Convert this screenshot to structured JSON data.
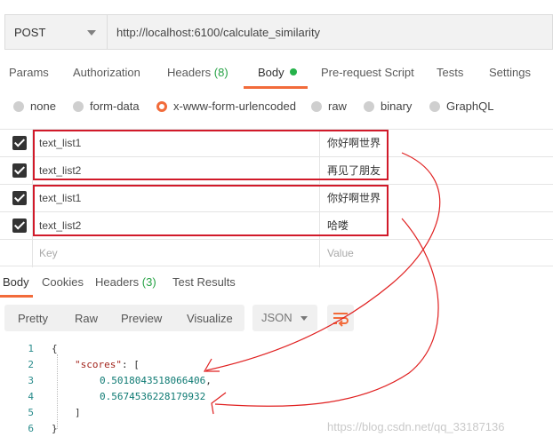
{
  "request": {
    "method": "POST",
    "url": "http://localhost:6100/calculate_similarity"
  },
  "request_tabs": [
    {
      "label": "Params"
    },
    {
      "label": "Authorization"
    },
    {
      "label": "Headers",
      "count": "(8)"
    },
    {
      "label": "Body"
    },
    {
      "label": "Pre-request Script"
    },
    {
      "label": "Tests"
    },
    {
      "label": "Settings"
    }
  ],
  "body_types": [
    {
      "label": "none"
    },
    {
      "label": "form-data"
    },
    {
      "label": "x-www-form-urlencoded"
    },
    {
      "label": "raw"
    },
    {
      "label": "binary"
    },
    {
      "label": "GraphQL"
    }
  ],
  "params": [
    {
      "key": "text_list1",
      "value": "你好啊世界"
    },
    {
      "key": "text_list2",
      "value": "再见了朋友"
    },
    {
      "key": "text_list1",
      "value": "你好啊世界"
    },
    {
      "key": "text_list2",
      "value": "哈喽"
    }
  ],
  "placeholder": {
    "key": "Key",
    "value": "Value"
  },
  "response_tabs": [
    {
      "label": "Body"
    },
    {
      "label": "Cookies"
    },
    {
      "label": "Headers",
      "count": "(3)"
    },
    {
      "label": "Test Results"
    }
  ],
  "view_modes": [
    "Pretty",
    "Raw",
    "Preview",
    "Visualize"
  ],
  "format": "JSON",
  "code_lines": [
    {
      "n": "1",
      "text": "{"
    },
    {
      "n": "2",
      "key": "\"scores\"",
      "rest": ": ["
    },
    {
      "n": "3",
      "num": "0.5018043518066406",
      "rest": ","
    },
    {
      "n": "4",
      "num": "0.5674536228179932"
    },
    {
      "n": "5",
      "text": "]"
    },
    {
      "n": "6",
      "text": "}"
    }
  ],
  "watermark": "https://blog.csdn.net/qq_33187136",
  "colors": {
    "accent": "#f26b3a",
    "highlight_box": "#d11a2a",
    "annotation": "#e02020"
  }
}
